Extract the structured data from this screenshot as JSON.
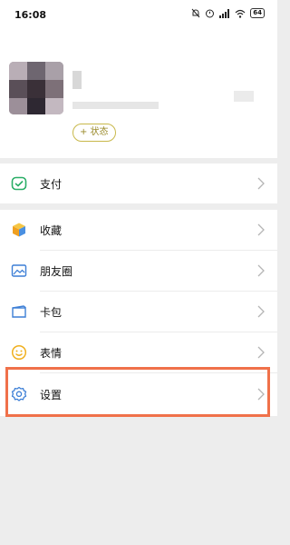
{
  "status_bar": {
    "time": "16:08",
    "battery": "64"
  },
  "profile": {
    "status_button": "+ 状态"
  },
  "menu": {
    "pay": "支付",
    "favorites": "收藏",
    "moments": "朋友圈",
    "cards": "卡包",
    "stickers": "表情",
    "settings": "设置"
  },
  "colors": {
    "pay_icon": "#2aae67",
    "highlight": "#f0714a",
    "status_pill": "#c8b84a"
  }
}
